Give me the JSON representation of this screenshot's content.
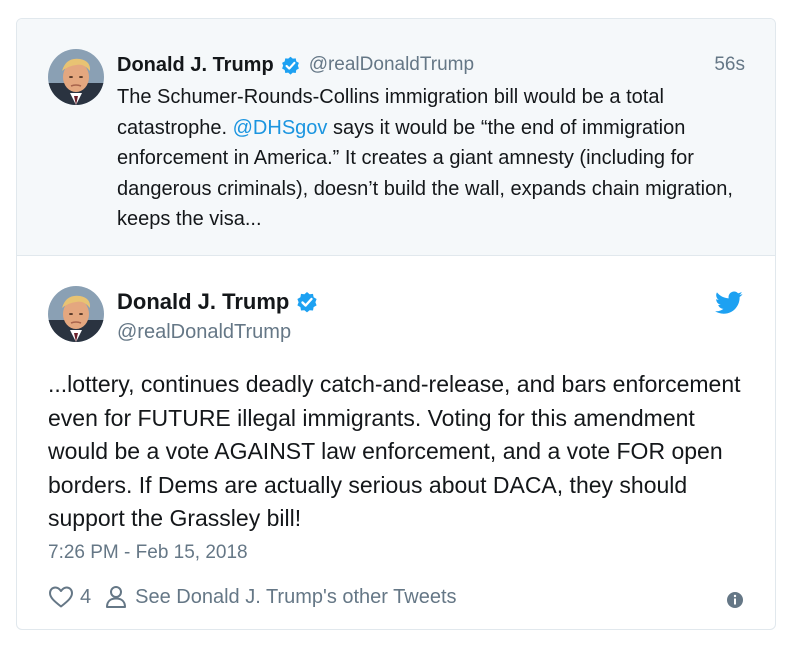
{
  "quoted_tweet": {
    "author_name": "Donald J. Trump",
    "author_handle": "@realDonaldTrump",
    "timestamp": "56s",
    "text_before_mention": "The Schumer-Rounds-Collins immigration bill would be a total catastrophe. ",
    "mention": "@DHSgov",
    "text_after_mention": " says it would be “the end of immigration enforcement in America.” It creates a giant amnesty (including for dangerous criminals), doesn’t build the wall, expands chain migration, keeps the visa..."
  },
  "main_tweet": {
    "author_name": "Donald J. Trump",
    "author_handle": "@realDonaldTrump",
    "text": "...lottery, continues deadly catch-and-release, and bars enforcement even for FUTURE illegal immigrants. Voting for this amendment would be a vote AGAINST law enforcement, and a vote FOR open borders. If Dems are actually serious about DACA, they should support the Grassley bill!",
    "date": "7:26 PM - Feb 15, 2018",
    "like_count": "4",
    "see_other_label": "See Donald J. Trump's other Tweets"
  },
  "icons": {
    "verified": "verified-badge-icon",
    "twitter": "twitter-bird-icon",
    "like": "heart-icon",
    "profile": "person-icon",
    "info": "info-icon"
  },
  "colors": {
    "accent": "#1da1f2",
    "mention": "#1b95e0",
    "muted": "#657786",
    "parent_bg": "#f5f8fa"
  }
}
